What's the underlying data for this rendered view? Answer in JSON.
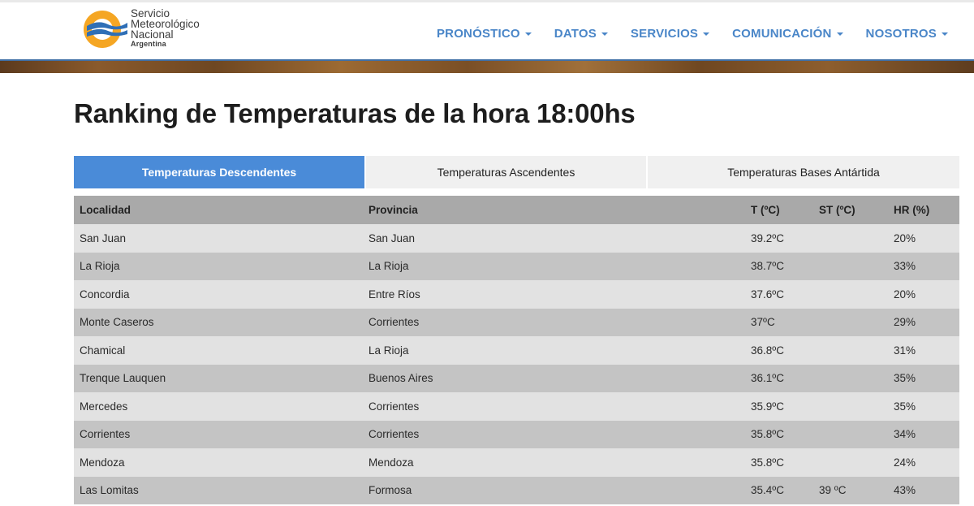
{
  "header": {
    "logo": {
      "line1": "Servicio",
      "line2": "Meteorológico",
      "line3": "Nacional",
      "country": "Argentina",
      "icon": "smn-logo-icon"
    },
    "nav": [
      {
        "label": "PRONÓSTICO"
      },
      {
        "label": "DATOS"
      },
      {
        "label": "SERVICIOS"
      },
      {
        "label": "COMUNICACIÓN"
      },
      {
        "label": "NOSOTROS"
      }
    ]
  },
  "page": {
    "title": "Ranking de Temperaturas de la hora 18:00hs"
  },
  "tabs": [
    {
      "label": "Temperaturas Descendentes",
      "active": true
    },
    {
      "label": "Temperaturas Ascendentes",
      "active": false
    },
    {
      "label": "Temperaturas Bases Antártida",
      "active": false
    }
  ],
  "table": {
    "headers": [
      "Localidad",
      "Provincia",
      "T (ºC)",
      "ST (ºC)",
      "HR (%)"
    ],
    "rows": [
      [
        "San Juan",
        "San Juan",
        "39.2ºC",
        "",
        "20%"
      ],
      [
        "La Rioja",
        "La Rioja",
        "38.7ºC",
        "",
        "33%"
      ],
      [
        "Concordia",
        "Entre Ríos",
        "37.6ºC",
        "",
        "20%"
      ],
      [
        "Monte Caseros",
        "Corrientes",
        "37ºC",
        "",
        "29%"
      ],
      [
        "Chamical",
        "La Rioja",
        "36.8ºC",
        "",
        "31%"
      ],
      [
        "Trenque Lauquen",
        "Buenos Aires",
        "36.1ºC",
        "",
        "35%"
      ],
      [
        "Mercedes",
        "Corrientes",
        "35.9ºC",
        "",
        "35%"
      ],
      [
        "Corrientes",
        "Corrientes",
        "35.8ºC",
        "",
        "34%"
      ],
      [
        "Mendoza",
        "Mendoza",
        "35.8ºC",
        "",
        "24%"
      ],
      [
        "Las Lomitas",
        "Formosa",
        "35.4ºC",
        "39 ºC",
        "43%"
      ]
    ]
  },
  "colors": {
    "accent": "#4a8bd8",
    "nav_text": "#4a86c8",
    "row_light": "#e2e2e2",
    "row_dark": "#c4c4c4",
    "header_row": "#a9a9a9",
    "logo_orange": "#f5a623",
    "logo_blue": "#2f6fb6"
  }
}
